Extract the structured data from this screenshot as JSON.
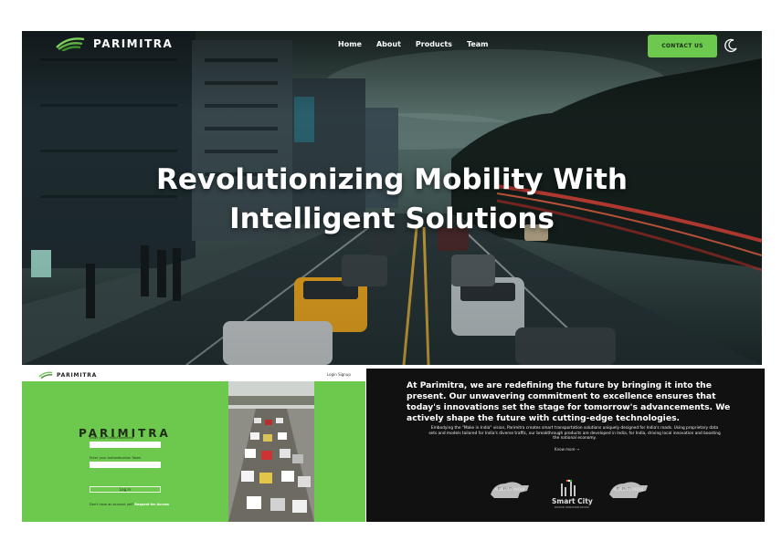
{
  "hero": {
    "brand": "PARIMITRA",
    "nav": [
      "Home",
      "About",
      "Products",
      "Team"
    ],
    "contact_label": "CONTACT US",
    "headline": "Revolutionizing Mobility With Intelligent Solutions",
    "theme_icon": "moon-icon",
    "accent_color": "#6cc94e"
  },
  "login": {
    "brand": "PARIMITRA",
    "top_brand": "PARIMITRA",
    "top_nav": "Login  Signup",
    "title": "PARIMITRA",
    "username_label": "Enter your Email/Username",
    "password_label": "Enter your Authentication Token",
    "button_label": "Log in",
    "signup_prefix": "Don't have an account yet? ",
    "signup_link": "Request for Access"
  },
  "about": {
    "heading": "At Parimitra, we are redefining the future by bringing it into the present. Our unwavering commitment to excellence ensures that today's innovations set the stage for tomorrow's advancements. We actively shape the future with cutting-edge technologies.",
    "body": "Embodying the \"Make in India\" vision, Parimitra creates smart transportation solutions uniquely designed for India's roads. Using proprietary data sets and models tailored for India's diverse traffic, our breakthrough products are developed in India, for India, driving local innovation and boosting the national economy.",
    "link": "Know more →",
    "badges": [
      "MAKE IN INDIA",
      "Smart City",
      "MAKE IN INDIA"
    ],
    "smart_city_sub": "MISSION TRANSFORM-NATION"
  }
}
